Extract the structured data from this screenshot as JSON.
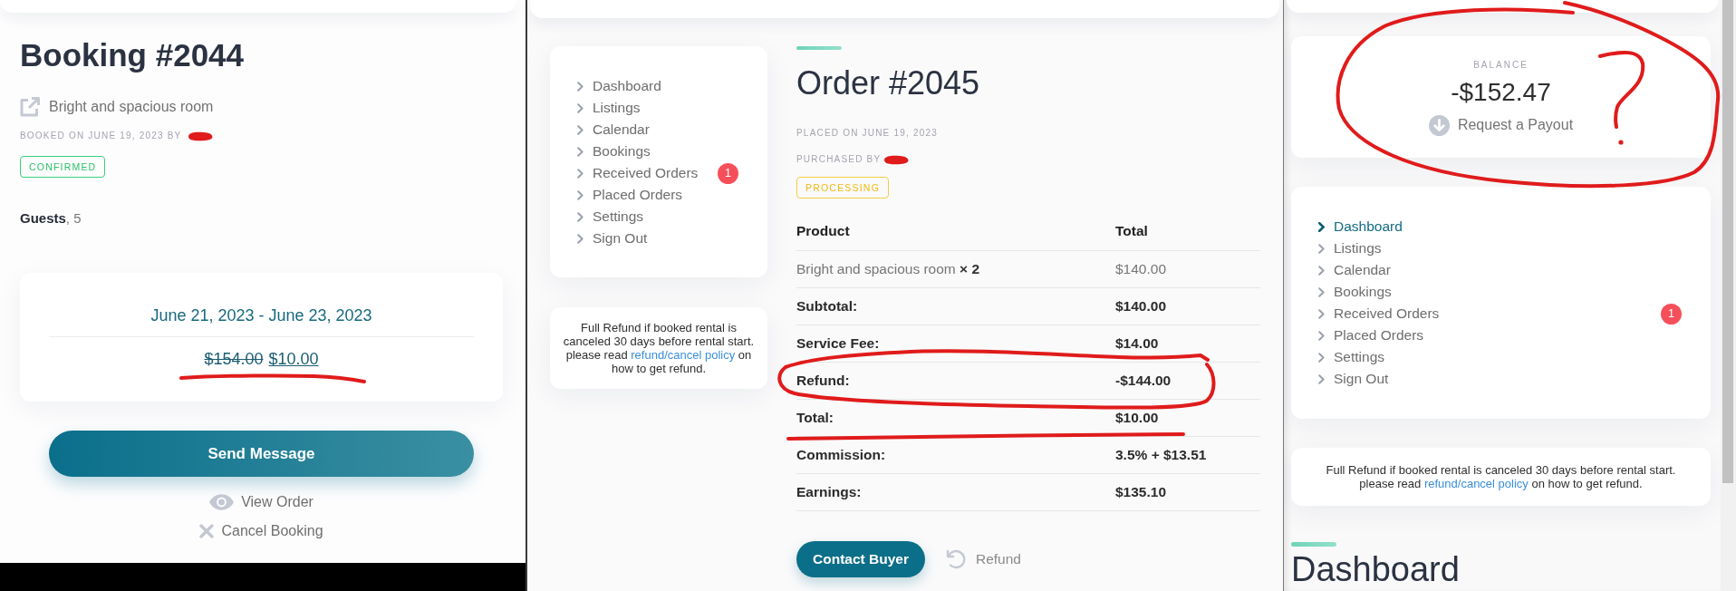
{
  "booking": {
    "title": "Booking #2044",
    "listing_link": "Bright and spacious room",
    "booked_on": {
      "text": "BOOKED ON JUNE 19, 2023 BY",
      "redacted": true
    },
    "status": {
      "label": "CONFIRMED",
      "kind": "confirmed"
    },
    "guests": "**Guests**, 5",
    "dates": "June 21, 2023 - June 23, 2023",
    "price": {
      "original": "$154.00",
      "current": "$10.00",
      "red_underline": true
    },
    "primary_button": "Send Message",
    "actions": [
      {
        "label": "View Order"
      },
      {
        "label": "Cancel Booking"
      }
    ]
  },
  "order": {
    "sidebar": {
      "items": [
        {
          "label": "Dashboard",
          "selected": false
        },
        {
          "label": "Listings",
          "selected": false
        },
        {
          "label": "Calendar",
          "selected": false
        },
        {
          "label": "Bookings",
          "selected": false
        },
        {
          "label": "Received Orders",
          "selected": false,
          "badge": "1"
        },
        {
          "label": "Placed Orders",
          "selected": false
        },
        {
          "label": "Settings",
          "selected": false
        },
        {
          "label": "Sign Out",
          "selected": false
        }
      ]
    },
    "refund_note": {
      "text": "Full Refund if booked rental is canceled 30 days before rental start.",
      "before": "please read",
      "link": "refund/cancel policy",
      "after": "on how to get refund."
    },
    "title": "Order #2045",
    "placed_on": "PLACED ON JUNE 19, 2023",
    "purchased_by": {
      "text": "PURCHASED BY",
      "redacted": true
    },
    "status": {
      "label": "PROCESSING",
      "kind": "processing"
    },
    "table": {
      "columns": [
        "Product",
        "Total"
      ],
      "rows": [
        {
          "kind": "item",
          "cells": [
            "Bright and spacious room **× 2**",
            "$140.00"
          ],
          "red_circle": false,
          "red_underline": false
        },
        {
          "kind": "summary",
          "cells": [
            "Subtotal:",
            "$140.00"
          ],
          "red_circle": false,
          "red_underline": false
        },
        {
          "kind": "summary",
          "cells": [
            "Service Fee:",
            "$14.00"
          ],
          "red_circle": false,
          "red_underline": false
        },
        {
          "kind": "summary",
          "cells": [
            "Refund:",
            "-$144.00"
          ],
          "red_circle": true,
          "red_underline": false
        },
        {
          "kind": "summary",
          "cells": [
            "Total:",
            "$10.00"
          ],
          "red_circle": false,
          "red_underline": true
        },
        {
          "kind": "summary",
          "cells": [
            "Commission:",
            "3.5% + $13.51"
          ],
          "red_circle": false,
          "red_underline": false
        },
        {
          "kind": "summary",
          "cells": [
            "Earnings:",
            "$135.10"
          ],
          "red_circle": false,
          "red_underline": false
        }
      ]
    },
    "buttons": [
      {
        "label": "Contact Buyer",
        "kind": "primary"
      },
      {
        "label": "Refund",
        "kind": "link"
      }
    ]
  },
  "dashboard": {
    "balance": {
      "label": "BALANCE",
      "amount": "-$152.47",
      "action": "Request a Payout",
      "red_circle": true,
      "red_question_mark": true
    },
    "sidebar": {
      "items": [
        {
          "label": "Dashboard",
          "selected": true
        },
        {
          "label": "Listings",
          "selected": false
        },
        {
          "label": "Calendar",
          "selected": false
        },
        {
          "label": "Bookings",
          "selected": false
        },
        {
          "label": "Received Orders",
          "selected": false,
          "badge": "1"
        },
        {
          "label": "Placed Orders",
          "selected": false
        },
        {
          "label": "Settings",
          "selected": false
        },
        {
          "label": "Sign Out",
          "selected": false
        }
      ]
    },
    "refund_note": {
      "text": "Full Refund if booked rental is canceled 30 days before rental start.",
      "before": "please read",
      "link": "refund/cancel policy",
      "after": "on how to get refund."
    },
    "heading": "Dashboard"
  }
}
